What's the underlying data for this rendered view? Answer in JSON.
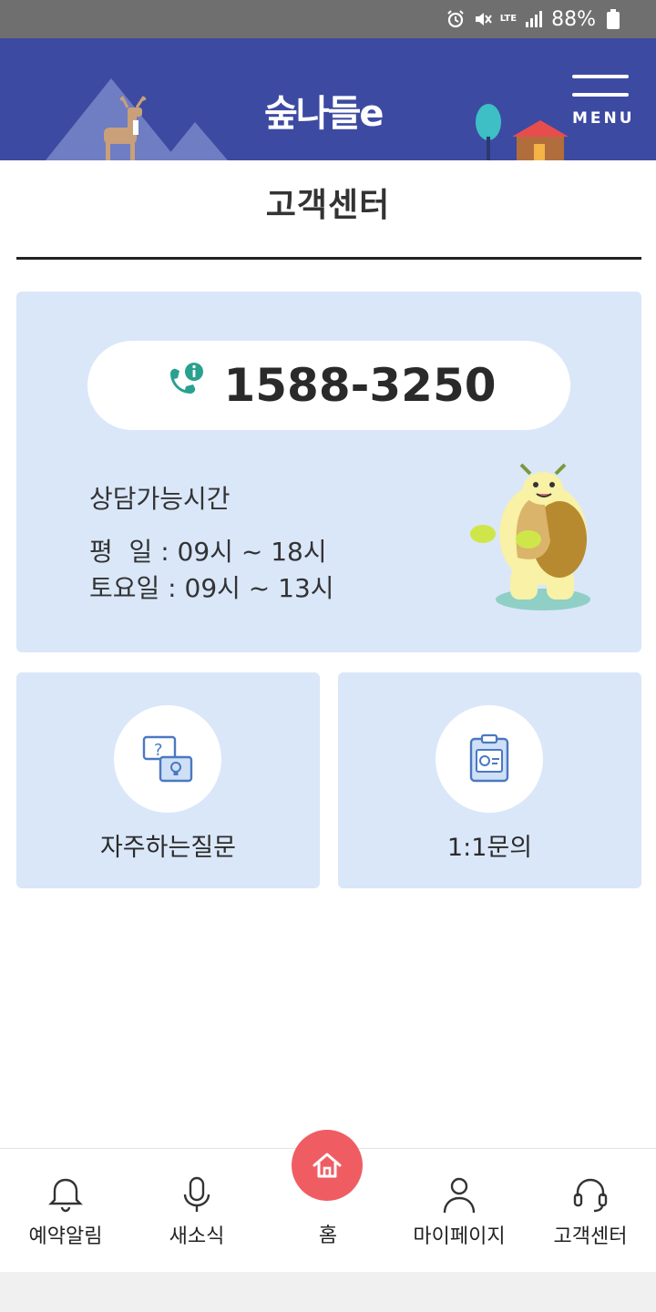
{
  "status_bar": {
    "alarm_icon": "alarm-icon",
    "mute_icon": "mute-icon",
    "network": "LTE",
    "signal_icon": "signal-icon",
    "battery_percent": "88%",
    "battery_icon": "battery-icon"
  },
  "header": {
    "logo_text": "숲나들e",
    "menu_label": "MENU",
    "background_color": "#3d4aa2"
  },
  "page": {
    "title": "고객센터"
  },
  "contact": {
    "phone_icon": "phone-info-icon",
    "phone_number": "1588-3250",
    "hours_title": "상담가능시간",
    "weekday": "평  일 : 09시 ~ 18시",
    "saturday": "토요일 : 09시 ~ 13시",
    "card_color": "#dae7f9"
  },
  "menu_cards": [
    {
      "label": "자주하는질문",
      "icon": "faq-chat-icon"
    },
    {
      "label": "1:1문의",
      "icon": "clipboard-inquiry-icon"
    }
  ],
  "bottom_nav": {
    "items": [
      {
        "label": "예약알림",
        "icon": "bell-icon"
      },
      {
        "label": "새소식",
        "icon": "microphone-icon"
      },
      {
        "label": "홈",
        "icon": "home-icon"
      },
      {
        "label": "마이페이지",
        "icon": "person-icon"
      },
      {
        "label": "고객센터",
        "icon": "headset-icon"
      }
    ],
    "home_color": "#ef5d63"
  }
}
